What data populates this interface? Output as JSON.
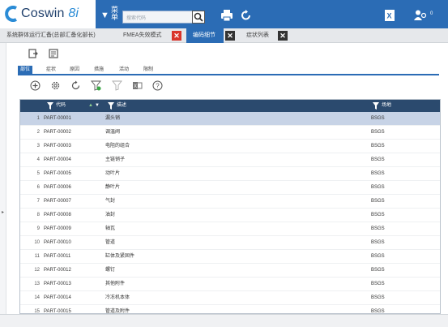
{
  "app": {
    "logo": "Coswin",
    "logo_version": "8i"
  },
  "header": {
    "menu_label": "菜单",
    "search_placeholder": "搜索代码",
    "user_badge": "0"
  },
  "tabs": [
    {
      "label": "系统群体运行汇备(总部汇备化部长)"
    },
    {
      "label": "FMEA失效模式"
    },
    {
      "label": "编码细节"
    },
    {
      "label": "症状列表"
    }
  ],
  "subtabs": [
    {
      "label": "部位"
    },
    {
      "label": "症状"
    },
    {
      "label": "原因"
    },
    {
      "label": "措施"
    },
    {
      "label": "活动"
    },
    {
      "label": "限制"
    }
  ],
  "grid": {
    "columns": {
      "code": "代码",
      "desc": "描述",
      "site": "场地"
    },
    "rows": [
      {
        "n": "1",
        "code": "PART-00001",
        "desc": "漏头销",
        "site": "BSGS"
      },
      {
        "n": "2",
        "code": "PART-00002",
        "desc": "调温阀",
        "site": "BSGS"
      },
      {
        "n": "3",
        "code": "PART-00003",
        "desc": "电阻的组合",
        "site": "BSGS"
      },
      {
        "n": "4",
        "code": "PART-00004",
        "desc": "主链销子",
        "site": "BSGS"
      },
      {
        "n": "5",
        "code": "PART-00005",
        "desc": "动叶片",
        "site": "BSGS"
      },
      {
        "n": "6",
        "code": "PART-00006",
        "desc": "静叶片",
        "site": "BSGS"
      },
      {
        "n": "7",
        "code": "PART-00007",
        "desc": "气封",
        "site": "BSGS"
      },
      {
        "n": "8",
        "code": "PART-00008",
        "desc": "油封",
        "site": "BSGS"
      },
      {
        "n": "9",
        "code": "PART-00009",
        "desc": "轴瓦",
        "site": "BSGS"
      },
      {
        "n": "10",
        "code": "PART-00010",
        "desc": "管道",
        "site": "BSGS"
      },
      {
        "n": "11",
        "code": "PART-00011",
        "desc": "缸体及紧固件",
        "site": "BSGS"
      },
      {
        "n": "12",
        "code": "PART-00012",
        "desc": "螺钉",
        "site": "BSGS"
      },
      {
        "n": "13",
        "code": "PART-00013",
        "desc": "其他附件",
        "site": "BSGS"
      },
      {
        "n": "14",
        "code": "PART-00014",
        "desc": "冷冻机本体",
        "site": "BSGS"
      },
      {
        "n": "15",
        "code": "PART-00015",
        "desc": "管道及附件",
        "site": "BSGS"
      }
    ]
  },
  "colors": {
    "brand": "#2b6cb5",
    "header_dark": "#2b4a6e",
    "close_red": "#d9342b",
    "selected_row": "#c7d3e6"
  }
}
